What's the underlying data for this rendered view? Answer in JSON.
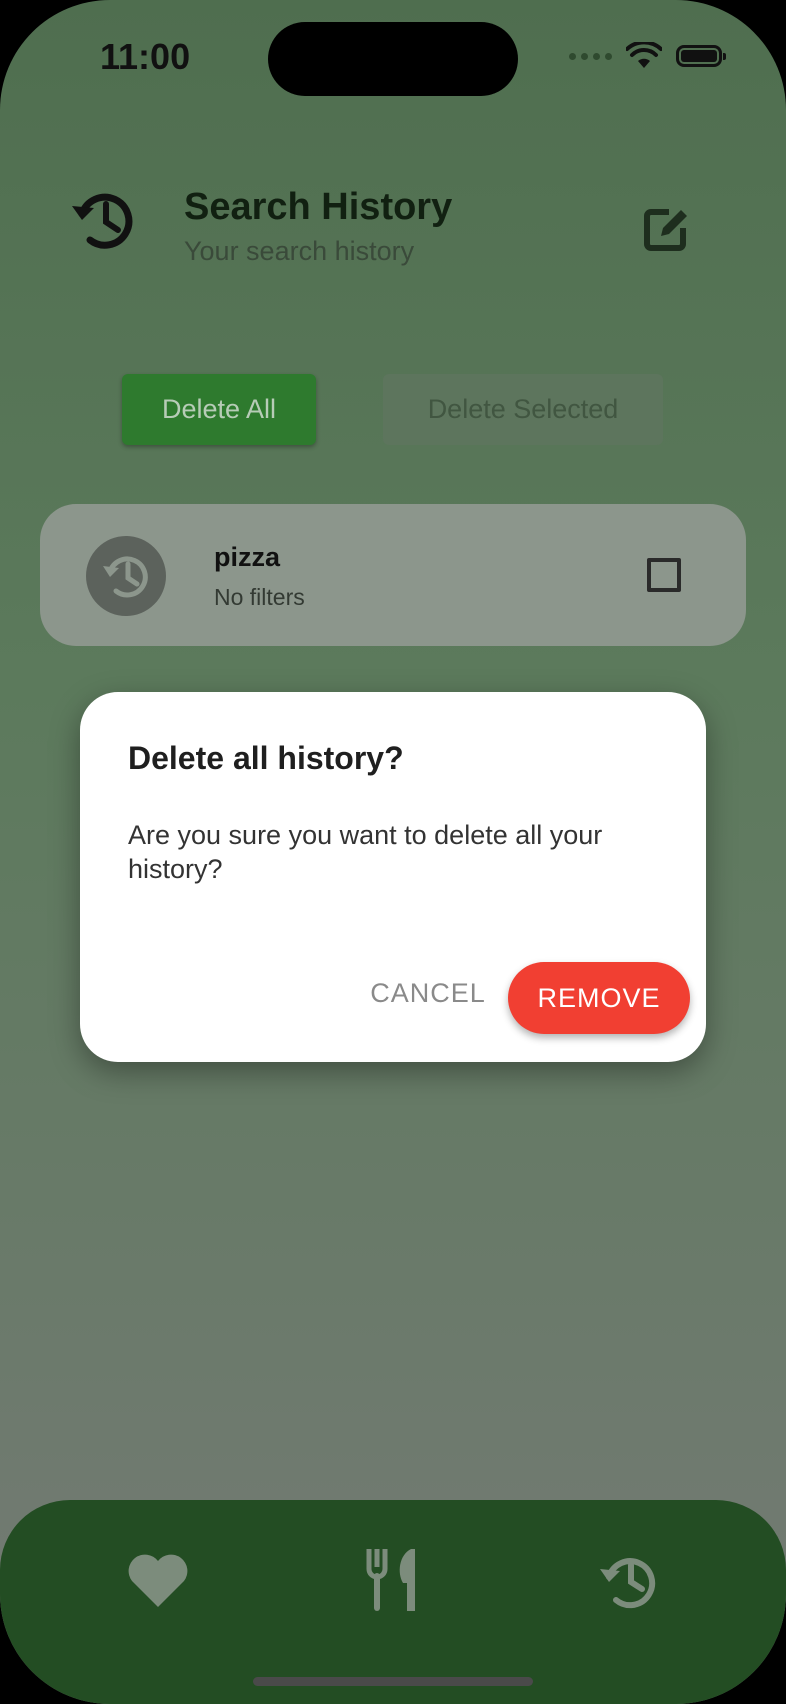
{
  "status_bar": {
    "time": "11:00"
  },
  "header": {
    "title": "Search History",
    "subtitle": "Your search history",
    "icon": "history-icon",
    "edit_icon": "edit-icon"
  },
  "actions": {
    "delete_all": "Delete All",
    "delete_selected": "Delete Selected"
  },
  "history_items": [
    {
      "query": "pizza",
      "filters": "No filters",
      "checked": false
    }
  ],
  "dialog": {
    "title": "Delete all history?",
    "message": "Are you sure you want to delete all your history?",
    "cancel": "CANCEL",
    "confirm": "REMOVE"
  },
  "bottom_nav": {
    "items": [
      "heart-icon",
      "restaurant-icon",
      "history-icon"
    ]
  },
  "colors": {
    "accent": "#2e7a2e",
    "nav": "#234d23",
    "danger": "#f13f32"
  }
}
